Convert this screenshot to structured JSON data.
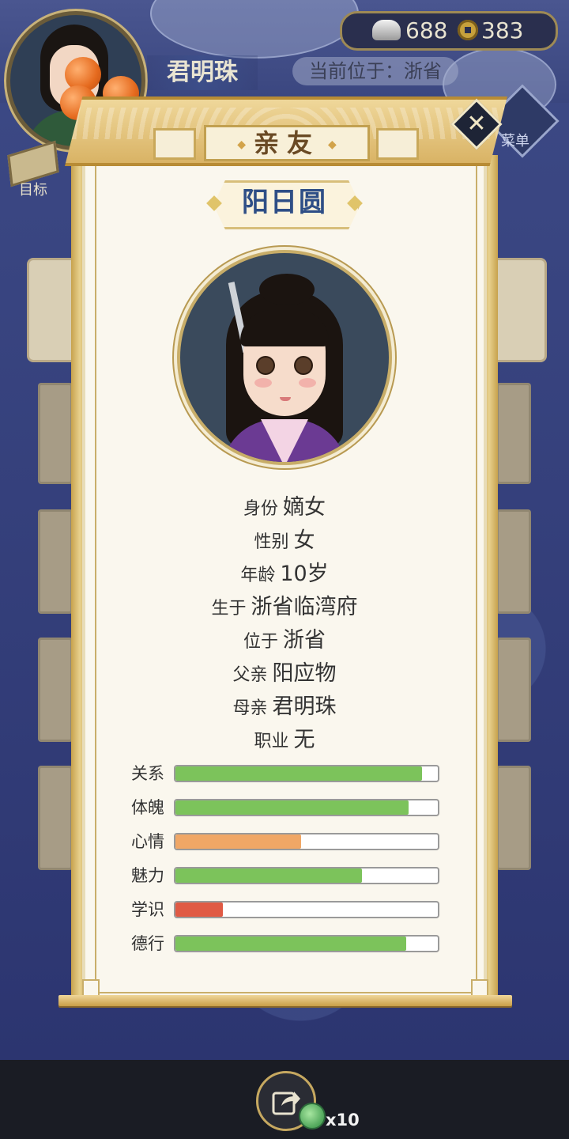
{
  "header": {
    "player_name": "君明珠",
    "location": "当前位于：浙省",
    "silver": "688",
    "coins": "383",
    "goal_label": "目标",
    "menu_label": "菜单"
  },
  "modal": {
    "title": "亲友",
    "npc_name": "阳日圆",
    "info": [
      {
        "key": "身份",
        "value": "嫡女"
      },
      {
        "key": "性别",
        "value": "女"
      },
      {
        "key": "年龄",
        "value": "10岁"
      },
      {
        "key": "生于",
        "value": "浙省临湾府"
      },
      {
        "key": "位于",
        "value": "浙省"
      },
      {
        "key": "父亲",
        "value": "阳应物"
      },
      {
        "key": "母亲",
        "value": "君明珠"
      },
      {
        "key": "职业",
        "value": "无"
      }
    ],
    "stats": [
      {
        "label": "关系",
        "fill": 0.94,
        "color": "#7cc35b"
      },
      {
        "label": "体魄",
        "fill": 0.89,
        "color": "#7cc35b"
      },
      {
        "label": "心情",
        "fill": 0.48,
        "color": "#f0a766"
      },
      {
        "label": "魅力",
        "fill": 0.71,
        "color": "#7cc35b"
      },
      {
        "label": "学识",
        "fill": 0.18,
        "color": "#e05a44"
      },
      {
        "label": "德行",
        "fill": 0.88,
        "color": "#7cc35b"
      }
    ]
  },
  "footer": {
    "reward_count": "x10"
  }
}
